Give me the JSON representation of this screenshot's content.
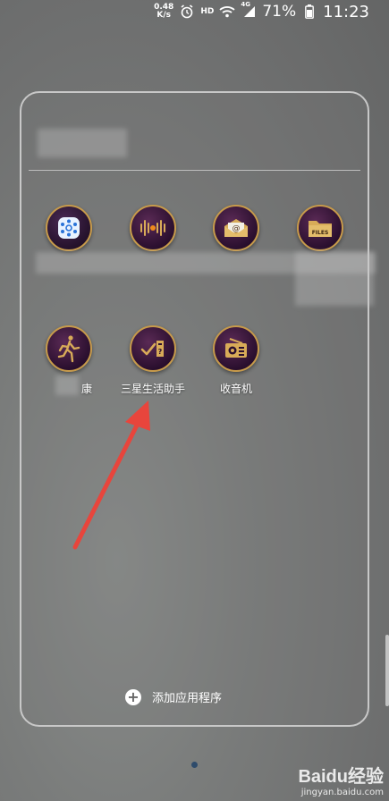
{
  "status_bar": {
    "net_speed_value": "0.48",
    "net_speed_unit": "K/s",
    "hd_label": "HD",
    "signal_label": "4G",
    "battery_percent": "71%",
    "time": "11:23"
  },
  "folder": {
    "name": "",
    "apps": [
      {
        "label": "",
        "icon": "network-hub-icon"
      },
      {
        "label": "",
        "icon": "sound-wave-icon"
      },
      {
        "label": "",
        "icon": "email-envelope-icon"
      },
      {
        "label": "",
        "icon": "files-folder-icon"
      },
      {
        "label": "康",
        "icon": "runner-icon"
      },
      {
        "label": "三星生活助手",
        "icon": "checklist-icon"
      },
      {
        "label": "收音机",
        "icon": "radio-icon"
      }
    ],
    "add_apps_label": "添加应用程序"
  },
  "watermark": {
    "logo": "Baidu经验",
    "url": "jingyan.baidu.com"
  },
  "colors": {
    "accent_gold": "#c79a4a",
    "icon_purple": "#2a0f2e",
    "arrow_red": "#e8453c"
  }
}
